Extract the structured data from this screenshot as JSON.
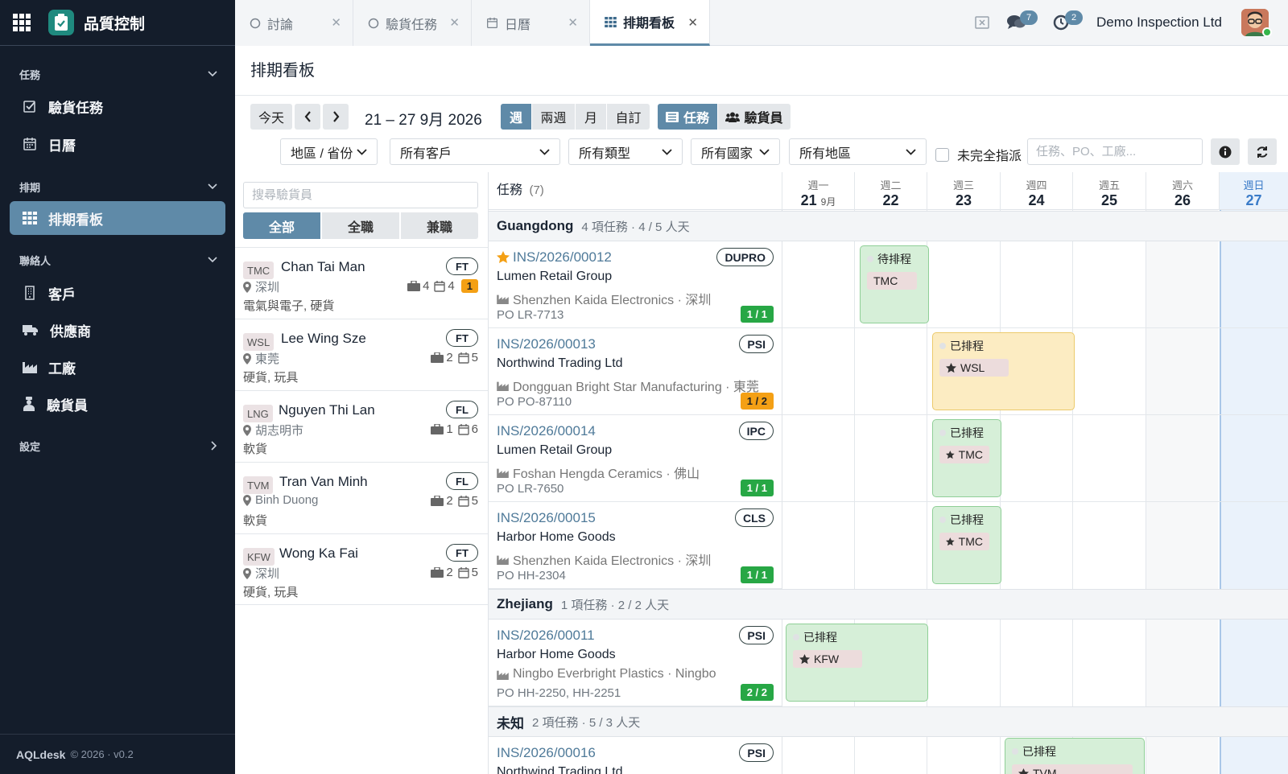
{
  "app": {
    "title": "品質控制",
    "footer_brand": "AQLdesk",
    "footer_meta": "© 2026 · v0.2"
  },
  "sidebar": {
    "sections": [
      {
        "label": "任務",
        "items": [
          {
            "label": "驗貨任務",
            "icon": "checkbox-icon"
          },
          {
            "label": "日曆",
            "icon": "calendar-icon"
          }
        ]
      },
      {
        "label": "排期",
        "items": [
          {
            "label": "排期看板",
            "icon": "grid-icon",
            "active": true
          }
        ]
      },
      {
        "label": "聯絡人",
        "items": [
          {
            "label": "客戶",
            "icon": "building-icon"
          },
          {
            "label": "供應商",
            "icon": "truck-icon"
          },
          {
            "label": "工廠",
            "icon": "factory-icon"
          },
          {
            "label": "驗貨員",
            "icon": "inspector-icon"
          }
        ]
      },
      {
        "label": "設定",
        "items": []
      }
    ]
  },
  "tabs": [
    {
      "label": "討論",
      "icon": "circle-icon"
    },
    {
      "label": "驗貨任務",
      "icon": "circle-icon"
    },
    {
      "label": "日曆",
      "icon": "calendar-icon"
    },
    {
      "label": "排期看板",
      "icon": "grid-icon",
      "active": true
    }
  ],
  "topbar": {
    "messages_count": "7",
    "activity_count": "2",
    "company": "Demo Inspection Ltd"
  },
  "page": {
    "title": "排期看板"
  },
  "toolbar": {
    "today": "今天",
    "date_range": "21 – 27 9月 2026",
    "views": [
      "週",
      "兩週",
      "月",
      "自訂"
    ],
    "task_btn": "任務",
    "inspector_btn": "驗貨員",
    "filters": [
      "地區 / 省份",
      "所有客戶",
      "所有類型",
      "所有國家",
      "所有地區"
    ],
    "unassigned_label": "未完全指派",
    "search_placeholder": "任務、PO、工廠..."
  },
  "inspectors_panel": {
    "search_placeholder": "搜尋驗貨員",
    "segments": [
      "全部",
      "全職",
      "兼職"
    ],
    "inspectors": [
      {
        "code": "TMC",
        "name": "Chan Tai Man",
        "type": "FT",
        "location": "深圳",
        "skills": "電氣與電子, 硬貨",
        "jobs": "4",
        "days": "4",
        "alert": "1"
      },
      {
        "code": "WSL",
        "name": "Lee Wing Sze",
        "type": "FT",
        "location": "東莞",
        "skills": "硬貨, 玩具",
        "jobs": "2",
        "days": "5"
      },
      {
        "code": "LNG",
        "name": "Nguyen Thi Lan",
        "type": "FL",
        "location": "胡志明市",
        "skills": "軟貨",
        "jobs": "1",
        "days": "6"
      },
      {
        "code": "TVM",
        "name": "Tran Van Minh",
        "type": "FL",
        "location": "Binh Duong",
        "skills": "軟貨",
        "jobs": "2",
        "days": "5"
      },
      {
        "code": "KFW",
        "name": "Wong Ka Fai",
        "type": "FT",
        "location": "深圳",
        "skills": "硬貨, 玩具",
        "jobs": "2",
        "days": "5"
      }
    ]
  },
  "grid": {
    "task_header": "任務",
    "task_count": "(7)",
    "days": [
      {
        "dow": "週一",
        "day": "21",
        "month": "9月"
      },
      {
        "dow": "週二",
        "day": "22"
      },
      {
        "dow": "週三",
        "day": "23"
      },
      {
        "dow": "週四",
        "day": "24"
      },
      {
        "dow": "週五",
        "day": "25"
      },
      {
        "dow": "週六",
        "day": "26"
      },
      {
        "dow": "週日",
        "day": "27",
        "today": true
      }
    ],
    "groups": [
      {
        "name": "Guangdong",
        "info": "4 項任務 · 4 / 5 人天"
      },
      {
        "name": "Zhejiang",
        "info": "1 項任務 · 2 / 2 人天"
      },
      {
        "name": "未知",
        "info": "2 項任務 · 5 / 3 人天"
      }
    ],
    "tasks": [
      {
        "id": "INS/2026/00012",
        "starred": true,
        "type": "DUPRO",
        "client": "Lumen Retail Group",
        "factory": "Shenzhen Kaida Electronics · 深圳",
        "po": "PO LR-7713",
        "count": "1 / 1",
        "count_status": "complete",
        "booking": {
          "status": "待排程",
          "inspector": "TMC",
          "starred": false,
          "color": "green"
        }
      },
      {
        "id": "INS/2026/00013",
        "type": "PSI",
        "client": "Northwind Trading Ltd",
        "factory": "Dongguan Bright Star Manufacturing · 東莞",
        "po": "PO PO-87110",
        "count": "1 / 2",
        "count_status": "partial",
        "booking": {
          "status": "已排程",
          "inspector": "WSL",
          "starred": true,
          "color": "yellow"
        }
      },
      {
        "id": "INS/2026/00014",
        "type": "IPC",
        "client": "Lumen Retail Group",
        "factory": "Foshan Hengda Ceramics · 佛山",
        "po": "PO LR-7650",
        "count": "1 / 1",
        "count_status": "complete",
        "booking": {
          "status": "已排程",
          "inspector": "TMC",
          "starred": true,
          "color": "green"
        }
      },
      {
        "id": "INS/2026/00015",
        "type": "CLS",
        "client": "Harbor Home Goods",
        "factory": "Shenzhen Kaida Electronics · 深圳",
        "po": "PO HH-2304",
        "count": "1 / 1",
        "count_status": "complete",
        "booking": {
          "status": "已排程",
          "inspector": "TMC",
          "starred": true,
          "color": "green"
        }
      },
      {
        "id": "INS/2026/00011",
        "type": "PSI",
        "client": "Harbor Home Goods",
        "factory": "Ningbo Everbright Plastics · Ningbo",
        "po": "PO HH-2250, HH-2251",
        "count": "2 / 2",
        "count_status": "complete",
        "booking": {
          "status": "已排程",
          "inspector": "KFW",
          "starred": true,
          "color": "green"
        }
      },
      {
        "id": "INS/2026/00016",
        "type": "PSI",
        "client": "Northwind Trading Ltd",
        "booking": {
          "status": "已排程",
          "inspector": "TVM",
          "starred": true,
          "color": "green"
        }
      }
    ]
  },
  "colors": {
    "accent": "#5f8aa8",
    "sidebar_bg": "#141d2b",
    "chip_green": "#d6efd8",
    "chip_yellow": "#fcecc2",
    "count_green": "#27a745",
    "count_orange": "#f4a015",
    "star": "#f4a015"
  }
}
